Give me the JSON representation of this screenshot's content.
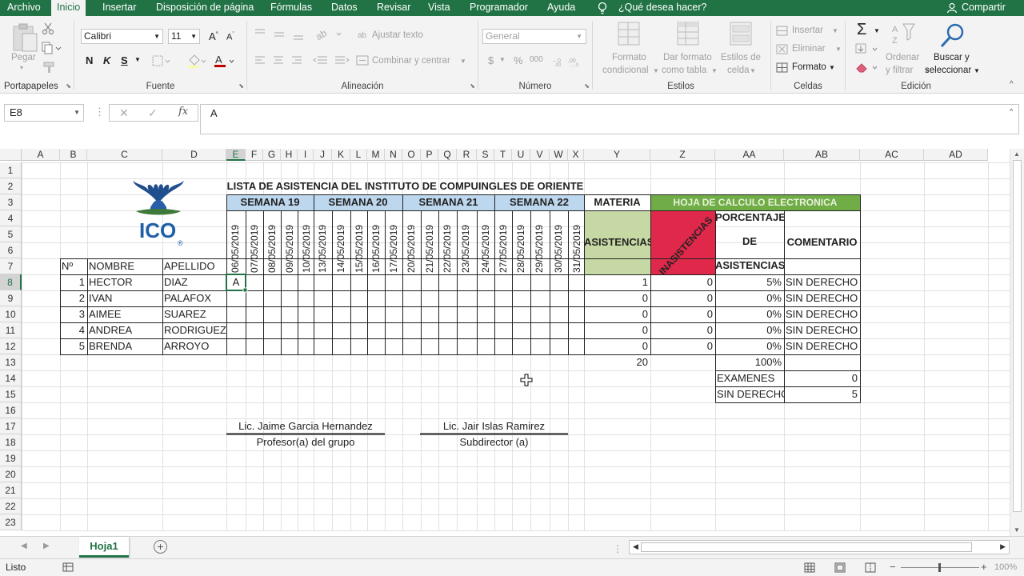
{
  "menu": {
    "tabs": [
      "Archivo",
      "Inicio",
      "Insertar",
      "Disposición de página",
      "Fórmulas",
      "Datos",
      "Revisar",
      "Vista",
      "Programador",
      "Ayuda"
    ],
    "active_tab": "Inicio",
    "tell_me": "¿Qué desea hacer?",
    "share": "Compartir"
  },
  "ribbon": {
    "clipboard": {
      "paste": "Pegar",
      "label": "Portapapeles"
    },
    "font": {
      "name": "Calibri",
      "size": "11",
      "bold": "N",
      "italic": "K",
      "underline": "S",
      "label": "Fuente"
    },
    "alignment": {
      "wrap": "Ajustar texto",
      "merge": "Combinar y centrar",
      "label": "Alineación"
    },
    "number": {
      "format": "General",
      "currency": "$",
      "percent": "%",
      "thousands": "000",
      "label": "Número"
    },
    "styles": {
      "conditional_1": "Formato",
      "conditional_2": "condicional",
      "table_1": "Dar formato",
      "table_2": "como tabla",
      "cell_1": "Estilos de",
      "cell_2": "celda",
      "label": "Estilos"
    },
    "cells": {
      "insert": "Insertar",
      "delete": "Eliminar",
      "format": "Formato",
      "label": "Celdas"
    },
    "editing": {
      "sort_1": "Ordenar",
      "sort_2": "y filtrar",
      "find_1": "Buscar y",
      "find_2": "seleccionar",
      "label": "Edición"
    }
  },
  "formula_bar": {
    "name_box": "E8",
    "fx": "fx",
    "value": "A"
  },
  "sheet": {
    "columns": [
      "A",
      "B",
      "C",
      "D",
      "E",
      "F",
      "G",
      "H",
      "I",
      "J",
      "K",
      "L",
      "M",
      "N",
      "O",
      "P",
      "Q",
      "R",
      "S",
      "T",
      "U",
      "V",
      "W",
      "X",
      "Y",
      "Z",
      "AA",
      "AB",
      "AC",
      "AD"
    ],
    "rows": [
      "1",
      "2",
      "3",
      "4",
      "5",
      "6",
      "7",
      "8",
      "9",
      "10",
      "11",
      "12",
      "13",
      "14",
      "15",
      "16",
      "17",
      "18",
      "19",
      "20",
      "21",
      "22",
      "23"
    ],
    "logo_text": "ICO",
    "logo_reg": "®",
    "title": "LISTA DE ASISTENCIA DEL INSTITUTO DE COMPUINGLES DE ORIENTE",
    "weeks": [
      "SEMANA 19",
      "SEMANA 20",
      "SEMANA 21",
      "SEMANA 22"
    ],
    "materia": "MATERIA",
    "hoja": "HOJA DE CALCULO ELECTRONICA",
    "dates": [
      "06/05/2019",
      "07/05/2019",
      "08/05/2019",
      "09/05/2019",
      "10/05/2019",
      "13/05/2019",
      "14/05/2019",
      "15/05/2019",
      "16/05/2019",
      "17/05/2019",
      "20/05/2019",
      "21/05/2019",
      "22/05/2019",
      "23/05/2019",
      "24/05/2019",
      "27/05/2019",
      "28/05/2019",
      "29/05/2019",
      "30/05/2019",
      "31/05/2019"
    ],
    "asistencias": "ASISTENCIAS",
    "inasistencias": "INASISTENCIAS",
    "porcentaje": [
      "PORCENTAJE",
      "DE",
      "ASISTENCIAS"
    ],
    "comentario": "COMENTARIO",
    "headers": {
      "num": "Nº",
      "nombre": "NOMBRE",
      "apellido": "APELLIDO"
    },
    "students": [
      {
        "n": "1",
        "nombre": "HECTOR",
        "apellido": "DIAZ",
        "mark": "A",
        "asist": "1",
        "inasist": "0",
        "pct": "5%",
        "coment": "SIN DERECHO"
      },
      {
        "n": "2",
        "nombre": "IVAN",
        "apellido": "PALAFOX",
        "mark": "",
        "asist": "0",
        "inasist": "0",
        "pct": "0%",
        "coment": "SIN DERECHO"
      },
      {
        "n": "3",
        "nombre": "AIMEE",
        "apellido": "SUAREZ",
        "mark": "",
        "asist": "0",
        "inasist": "0",
        "pct": "0%",
        "coment": "SIN DERECHO"
      },
      {
        "n": "4",
        "nombre": "ANDREA",
        "apellido": "RODRIGUEZ",
        "mark": "",
        "asist": "0",
        "inasist": "0",
        "pct": "0%",
        "coment": "SIN DERECHO"
      },
      {
        "n": "5",
        "nombre": "BRENDA",
        "apellido": "ARROYO",
        "mark": "",
        "asist": "0",
        "inasist": "0",
        "pct": "0%",
        "coment": "SIN DERECHO"
      }
    ],
    "total_days": "20",
    "total_pct": "100%",
    "summary": [
      {
        "label": "EXAMENES",
        "value": "0"
      },
      {
        "label": "SIN DERECHO",
        "value": "5"
      }
    ],
    "signatures": [
      {
        "name": "Lic. Jaime Garcia Hernandez",
        "role": "Profesor(a) del grupo"
      },
      {
        "name": "Lic. Jair Islas Ramirez",
        "role": "Subdirector (a)"
      }
    ]
  },
  "sheet_tabs": {
    "active": "Hoja1"
  },
  "status": {
    "ready": "Listo",
    "zoom": "100%"
  },
  "colors": {
    "accent": "#217346",
    "week_fill": "#bdd7ee",
    "asist_fill": "#c6d9a4",
    "inasist_fill": "#e0284a",
    "hoja_fill": "#70ad47"
  }
}
